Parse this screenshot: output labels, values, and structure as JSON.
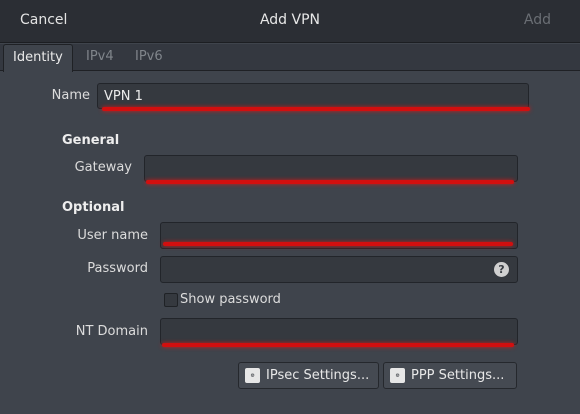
{
  "header": {
    "cancel_label": "Cancel",
    "title": "Add VPN",
    "add_label": "Add"
  },
  "tabs": [
    {
      "label": "Identity",
      "active": true
    },
    {
      "label": "IPv4",
      "active": false
    },
    {
      "label": "IPv6",
      "active": false
    }
  ],
  "form": {
    "name_label": "Name",
    "name_value": "VPN 1",
    "general_heading": "General",
    "gateway_label": "Gateway",
    "gateway_value": "",
    "optional_heading": "Optional",
    "username_label": "User name",
    "username_value": "",
    "password_label": "Password",
    "password_value": "",
    "show_password_label": "Show password",
    "show_password_checked": false,
    "ntdomain_label": "NT Domain",
    "ntdomain_value": ""
  },
  "buttons": {
    "ipsec_label": "IPsec Settings...",
    "ppp_label": "PPP Settings..."
  },
  "icons": {
    "password_help": "question-circle-icon",
    "settings": "settings-dialog-icon"
  },
  "colors": {
    "background": "#3f444c",
    "headerbar": "#2b2e34",
    "error_underline": "#d20f0f"
  }
}
